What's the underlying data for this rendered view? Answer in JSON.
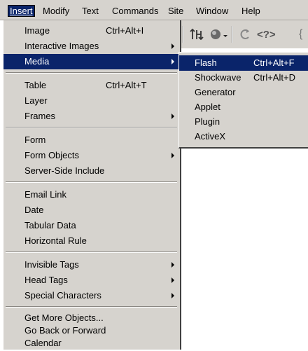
{
  "menubar": {
    "items": [
      "Insert",
      "Modify",
      "Text",
      "Commands",
      "Site",
      "Window",
      "Help"
    ],
    "active": "Insert"
  },
  "toolbar": {
    "icons": [
      "tree-icon",
      "globe-icon",
      "refresh-icon",
      "code-tags-icon",
      "brace-icon"
    ]
  },
  "insert_menu": {
    "group1": [
      {
        "label": "Image",
        "shortcut": "Ctrl+Alt+I"
      },
      {
        "label": "Interactive Images",
        "submenu": true
      },
      {
        "label": "Media",
        "submenu": true,
        "highlighted": true
      }
    ],
    "group2": [
      {
        "label": "Table",
        "shortcut": "Ctrl+Alt+T"
      },
      {
        "label": "Layer"
      },
      {
        "label": "Frames",
        "submenu": true
      }
    ],
    "group3": [
      {
        "label": "Form"
      },
      {
        "label": "Form Objects",
        "submenu": true
      },
      {
        "label": "Server-Side Include"
      }
    ],
    "group4": [
      {
        "label": "Email Link"
      },
      {
        "label": "Date"
      },
      {
        "label": "Tabular Data"
      },
      {
        "label": "Horizontal Rule"
      }
    ],
    "group5": [
      {
        "label": "Invisible Tags",
        "submenu": true
      },
      {
        "label": "Head Tags",
        "submenu": true
      },
      {
        "label": "Special Characters",
        "submenu": true
      }
    ],
    "group6": [
      {
        "label": "Get More Objects..."
      },
      {
        "label": "Go Back or Forward"
      },
      {
        "label": "Calendar"
      }
    ]
  },
  "media_submenu": [
    {
      "label": "Flash",
      "shortcut": "Ctrl+Alt+F",
      "highlighted": true
    },
    {
      "label": "Shockwave",
      "shortcut": "Ctrl+Alt+D"
    },
    {
      "label": "Generator"
    },
    {
      "label": "Applet"
    },
    {
      "label": "Plugin"
    },
    {
      "label": "ActiveX"
    }
  ],
  "colors": {
    "menu_bg": "#d6d3ce",
    "highlight": "#0a246a"
  }
}
